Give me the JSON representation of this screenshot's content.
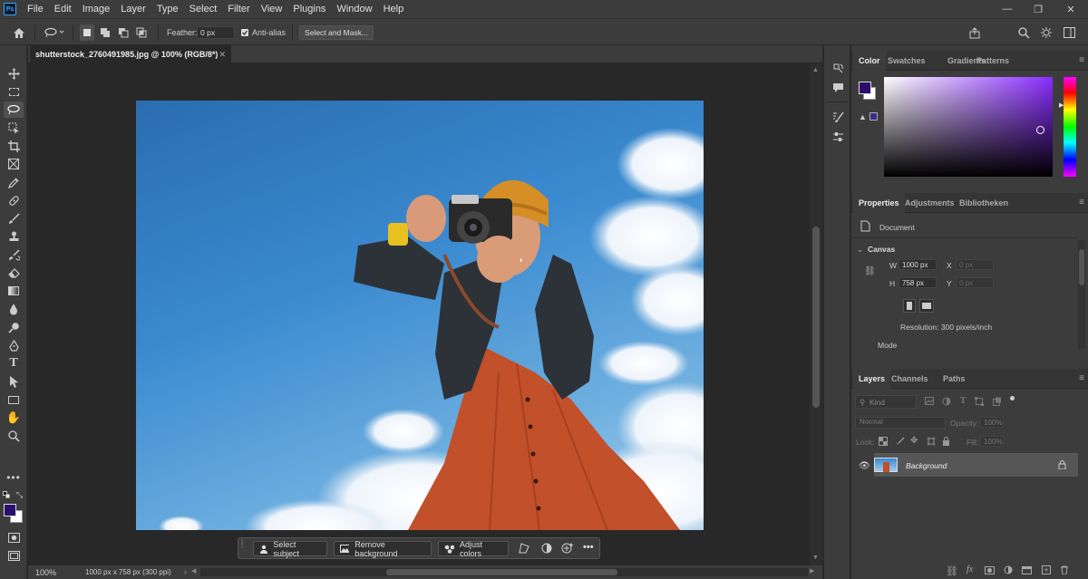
{
  "app": {
    "logo": "Ps"
  },
  "menu": [
    "File",
    "Edit",
    "Image",
    "Layer",
    "Type",
    "Select",
    "Filter",
    "View",
    "Plugins",
    "Window",
    "Help"
  ],
  "window_controls": {
    "minimize": "—",
    "maximize": "❐",
    "close": "✕"
  },
  "options": {
    "feather_label": "Feather:",
    "feather_value": "0 px",
    "antialias_label": "Anti-alias",
    "select_mask_label": "Select and Mask..."
  },
  "document": {
    "tab_title": "shutterstock_2760491985.jpg @ 100% (RGB/8*)",
    "zoom": "100%",
    "info": "1000 px x 758 px (300 ppi)"
  },
  "contextual_bar": {
    "select_subject": "Select subject",
    "remove_background": "Remove background",
    "adjust_colors": "Adjust colors"
  },
  "color_panel": {
    "tabs": [
      "Color",
      "Swatches",
      "Gradients",
      "Patterns"
    ],
    "foreground": "#2a0f6e",
    "background": "#ffffff",
    "hue_color": "#8a2cff"
  },
  "properties_panel": {
    "tabs": [
      "Properties",
      "Adjustments",
      "Bibliotheken"
    ],
    "document_label": "Document",
    "canvas_label": "Canvas",
    "w_label": "W",
    "w_value": "1000 px",
    "h_label": "H",
    "h_value": "758 px",
    "x_label": "X",
    "x_value": "0 px",
    "y_label": "Y",
    "y_value": "0 px",
    "resolution": "Resolution: 300 pixels/inch",
    "mode_label": "Mode"
  },
  "layers_panel": {
    "tabs": [
      "Layers",
      "Channels",
      "Paths"
    ],
    "kind_placeholder": "Kind",
    "blend_mode": "Normal",
    "opacity_label": "Opacity:",
    "opacity_value": "100%",
    "lock_label": "Lock:",
    "fill_label": "Fill:",
    "fill_value": "100%",
    "layer_name": "Background"
  }
}
